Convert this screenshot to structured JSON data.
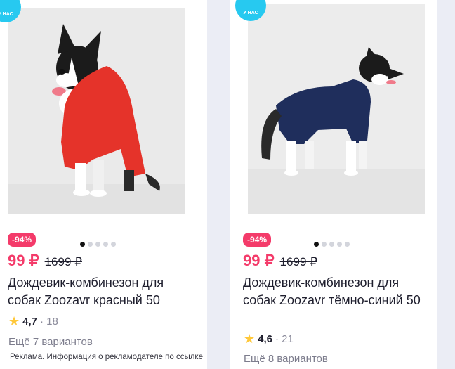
{
  "products": [
    {
      "badge": "У НАС",
      "discount": "-94%",
      "price": "99 ₽",
      "old_price": "1699 ₽",
      "title": "Дождевик-комбинезон для собак Zoozavr красный 50",
      "rating": "4,7",
      "reviews": "· 18",
      "variants": "Ещё 7 вариантов",
      "image_dots": 5,
      "active_dot": 1,
      "jacket_color": "#e5332a"
    },
    {
      "badge": "У НАС",
      "discount": "-94%",
      "price": "99 ₽",
      "old_price": "1699 ₽",
      "title": "Дождевик-комбинезон для собак Zoozavr тёмно-синий 50",
      "rating": "4,6",
      "reviews": "· 21",
      "variants": "Ещё 8 вариантов",
      "image_dots": 5,
      "active_dot": 1,
      "jacket_color": "#1f2e5c"
    }
  ],
  "ad_note": "Реклама. Информация о рекламодателе по ссылке",
  "colors": {
    "accent": "#f43b6a",
    "badge": "#27c9f0",
    "star": "#ffc83a"
  },
  "icons": {
    "rating": "star-icon"
  }
}
